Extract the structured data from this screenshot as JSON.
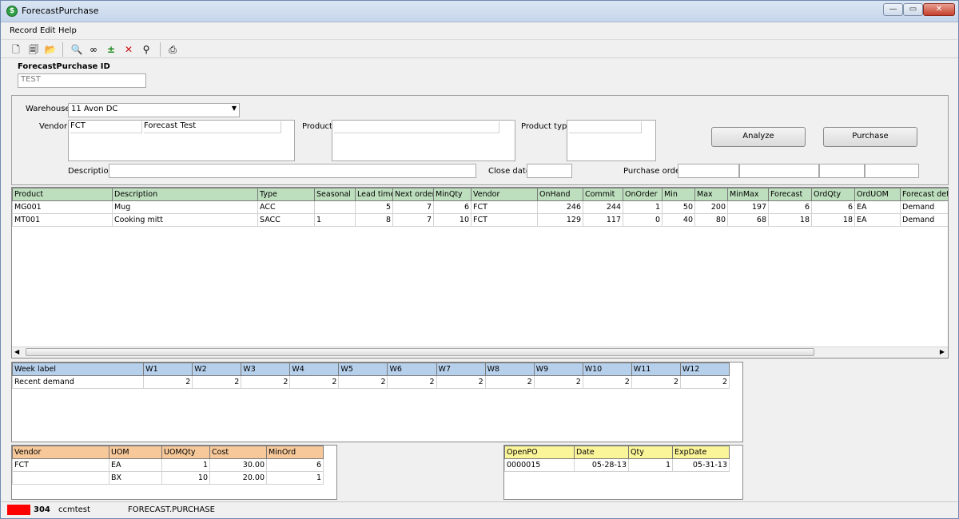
{
  "window": {
    "title": "ForecastPurchase",
    "minimize": "—",
    "maximize": "▭",
    "close": "✕"
  },
  "menu": [
    "Record",
    "Edit",
    "Help"
  ],
  "toolbar": {
    "icons": [
      "new-record-icon",
      "copy-record-icon",
      "open-folder-icon",
      "zoom-icon",
      "glasses-icon",
      "add-line-icon",
      "delete-line-icon",
      "find-icon",
      "print-icon"
    ],
    "glyphs": [
      "🗋",
      "🗐",
      "📂",
      "🔍",
      "∞",
      "±",
      "✕",
      "⚲",
      "⎙"
    ]
  },
  "header": {
    "id_label": "ForecastPurchase ID",
    "id_value": "TEST"
  },
  "form": {
    "warehouse_label": "Warehouse",
    "warehouse_value": "11 Avon DC",
    "vendor_label": "Vendor",
    "vendor_code": "FCT",
    "vendor_name": "Forecast Test",
    "product_label": "Product",
    "product_type_label": "Product type",
    "description_label": "Description",
    "close_date_label": "Close date",
    "purchase_order_label": "Purchase order",
    "analyze_label": "Analyze",
    "purchase_label": "Purchase"
  },
  "products": {
    "headers": [
      "Product",
      "Description",
      "Type",
      "Seasonal",
      "Lead time",
      "Next order",
      "MinQty",
      "Vendor",
      "OnHand",
      "Commit",
      "OnOrder",
      "Min",
      "Max",
      "MinMax",
      "Forecast",
      "OrdQty",
      "OrdUOM",
      "Forecast detail"
    ],
    "rows": [
      [
        "MG001",
        "Mug",
        "ACC",
        "",
        "5",
        "7",
        "6",
        "FCT",
        "246",
        "244",
        "1",
        "50",
        "200",
        "197",
        "6",
        "6",
        "EA",
        "Demand"
      ],
      [
        "MT001",
        "Cooking mitt",
        "SACC",
        "1",
        "8",
        "7",
        "10",
        "FCT",
        "129",
        "117",
        "0",
        "40",
        "80",
        "68",
        "18",
        "18",
        "EA",
        "Demand"
      ]
    ]
  },
  "weeks": {
    "headers": [
      "Week label",
      "W1",
      "W2",
      "W3",
      "W4",
      "W5",
      "W6",
      "W7",
      "W8",
      "W9",
      "W10",
      "W11",
      "W12"
    ],
    "rows": [
      [
        "Recent demand",
        "2",
        "2",
        "2",
        "2",
        "2",
        "2",
        "2",
        "2",
        "2",
        "2",
        "2",
        "2"
      ]
    ]
  },
  "vendors": {
    "headers": [
      "Vendor",
      "UOM",
      "UOMQty",
      "Cost",
      "MinOrd"
    ],
    "rows": [
      [
        "FCT",
        "EA",
        "1",
        "30.00",
        "6"
      ],
      [
        "",
        "BX",
        "10",
        "20.00",
        "1"
      ]
    ]
  },
  "openpo": {
    "headers": [
      "OpenPO",
      "Date",
      "Qty",
      "ExpDate"
    ],
    "rows": [
      [
        "0000015",
        "05-28-13",
        "1",
        "05-31-13"
      ]
    ]
  },
  "status": {
    "color": "#ff0000",
    "code": "304",
    "user": "ccmtest",
    "program": "FORECAST.PURCHASE"
  },
  "colors": {
    "product_header": "#bedfbe",
    "week_header": "#b6d0ec",
    "vendor_header": "#f6c89a",
    "openpo_header": "#fbf59a"
  }
}
